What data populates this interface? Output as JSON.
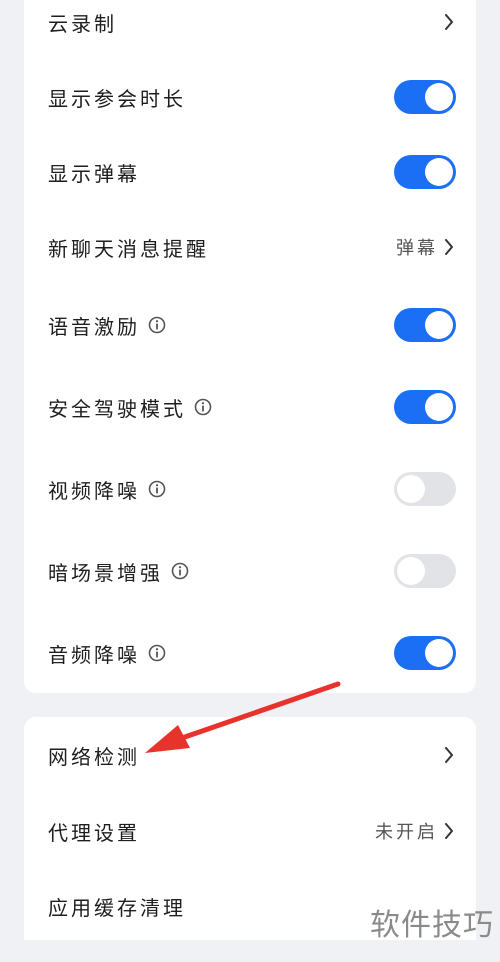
{
  "settings_group_1": [
    {
      "label": "云录制",
      "control": "chevron"
    },
    {
      "label": "显示参会时长",
      "control": "toggle",
      "on": true
    },
    {
      "label": "显示弹幕",
      "control": "toggle",
      "on": true
    },
    {
      "label": "新聊天消息提醒",
      "control": "chevron",
      "value": "弹幕"
    },
    {
      "label": "语音激励",
      "control": "toggle",
      "on": true,
      "info": true
    },
    {
      "label": "安全驾驶模式",
      "control": "toggle",
      "on": true,
      "info": true
    },
    {
      "label": "视频降噪",
      "control": "toggle",
      "on": false,
      "info": true
    },
    {
      "label": "暗场景增强",
      "control": "toggle",
      "on": false,
      "info": true
    },
    {
      "label": "音频降噪",
      "control": "toggle",
      "on": true,
      "info": true
    }
  ],
  "settings_group_2": [
    {
      "label": "网络检测",
      "control": "chevron"
    },
    {
      "label": "代理设置",
      "control": "chevron",
      "value": "未开启"
    },
    {
      "label": "应用缓存清理",
      "control": "none"
    }
  ],
  "watermark": "软件技巧",
  "colors": {
    "toggle_on": "#1b6ff5",
    "toggle_off": "#e2e3e7",
    "annotation_arrow": "#e8322c"
  }
}
